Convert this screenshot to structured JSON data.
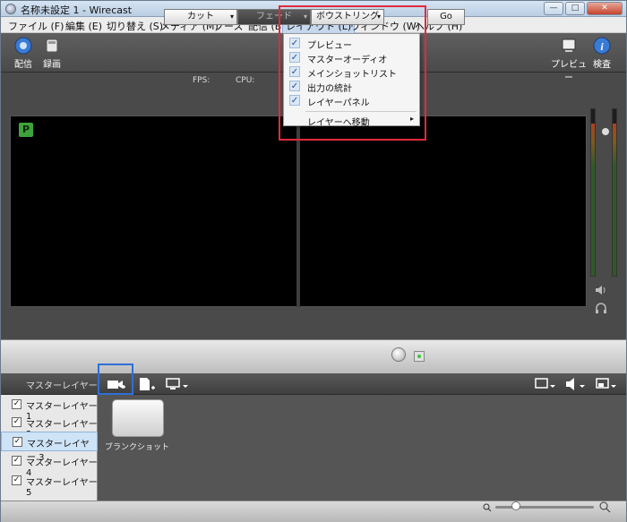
{
  "window": {
    "title": "名称未設定 1 - Wirecast"
  },
  "menu": [
    "ファイル (F)",
    "編集 (E)",
    "切り替え (S)",
    "メディア (M)",
    "ソース",
    "配信 (B)",
    "レイアウト (L)",
    "ウィンドウ (W)",
    "ヘルプ (H)"
  ],
  "toolbar": {
    "broadcast": "配信",
    "record": "録画",
    "preview": "プレビュー",
    "inspect": "検査"
  },
  "stats": {
    "fps": "FPS:",
    "cpu": "CPU:"
  },
  "badge": {
    "program": "P"
  },
  "layout_menu": {
    "items": [
      {
        "label": "プレビュー",
        "checked": true
      },
      {
        "label": "マスターオーディオ",
        "checked": true
      },
      {
        "label": "メインショットリスト",
        "checked": true
      },
      {
        "label": "出力の統計",
        "checked": true
      },
      {
        "label": "レイヤーパネル",
        "checked": true
      }
    ],
    "submenu": "レイヤーへ移動",
    "check": "✓",
    "arrow": "▸"
  },
  "switcher": {
    "cut": "カット",
    "fade": "フェード",
    "bowtie": "ボウストリング",
    "go": "Go",
    "arrow": "▾"
  },
  "layers": {
    "header": "マスターレイヤー",
    "items": [
      "マスターレイヤー 1",
      "マスターレイヤー 2",
      "マスターレイヤー 3",
      "マスターレイヤー 4",
      "マスターレイヤー 5"
    ],
    "selected_index": 2,
    "check": "✓"
  },
  "shots": {
    "blank": "ブランクショット"
  },
  "colors": {
    "accent_red": "#e02a3c",
    "accent_blue": "#2f6fd6",
    "program_green": "#3fa33c"
  }
}
